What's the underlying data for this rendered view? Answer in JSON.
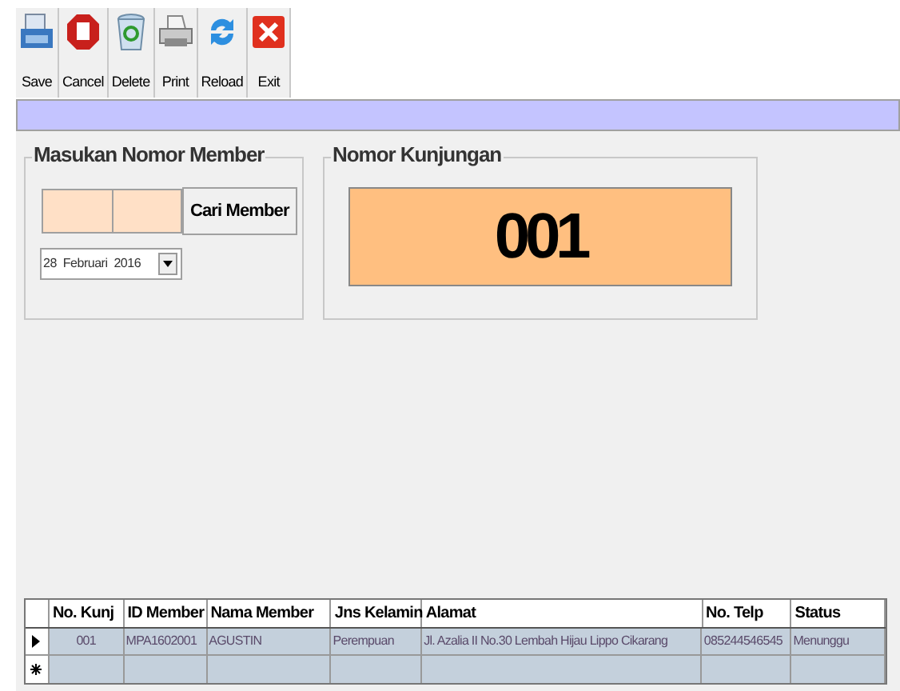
{
  "toolbar": [
    {
      "kind": "save",
      "label": "Save"
    },
    {
      "kind": "cancel",
      "label": "Cancel"
    },
    {
      "kind": "delete",
      "label": "Delete"
    },
    {
      "kind": "print",
      "label": "Print"
    },
    {
      "kind": "reload",
      "label": "Reload"
    },
    {
      "kind": "exit",
      "label": "Exit"
    }
  ],
  "member_group": {
    "title": "Masukan Nomor Member",
    "button": "Cari Member",
    "date": "28  Februari  2016"
  },
  "visit_group": {
    "title": "Nomor Kunjungan",
    "number": "001"
  },
  "table": {
    "columns": [
      "No. Kunj",
      "ID Member",
      "Nama Member",
      "Jns Kelamin",
      "Alamat",
      "No. Telp",
      "Status"
    ],
    "rows": [
      {
        "selected": true,
        "cells": [
          "001",
          "MPA1602001",
          "AGUSTIN",
          "Perempuan",
          "Jl. Azalia II No.30 Lembah Hijau Lippo Cikarang",
          "085244546545",
          "Menunggu"
        ]
      }
    ]
  }
}
